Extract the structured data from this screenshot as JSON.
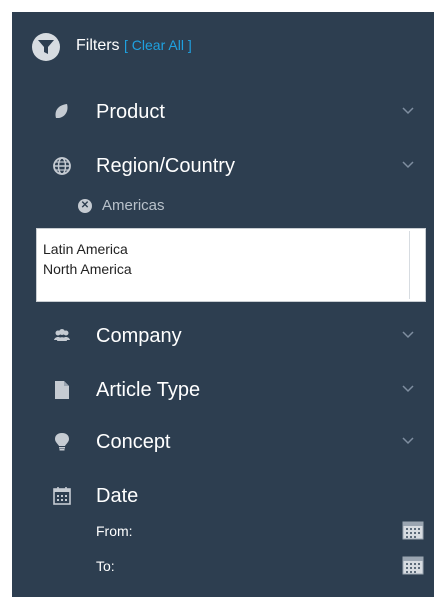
{
  "header": {
    "title": "Filters",
    "clear_all": "[ Clear All ]"
  },
  "filters": {
    "product": "Product",
    "region": "Region/Country",
    "company": "Company",
    "article_type": "Article Type",
    "concept": "Concept",
    "date": "Date"
  },
  "region_selected": {
    "chip": "Americas"
  },
  "region_options": [
    "Latin America",
    "North America"
  ],
  "date": {
    "from_label": "From:",
    "to_label": "To:"
  },
  "icons": {
    "header": "filter-icon",
    "product": "leaf-icon",
    "region": "globe-icon",
    "company": "users-icon",
    "article_type": "document-icon",
    "concept": "lightbulb-icon",
    "date": "calendar-icon",
    "expand": "chevron-down-icon",
    "remove": "close-circle-icon"
  },
  "colors": {
    "panel_bg": "#2d3e50",
    "accent": "#1fa1e0",
    "icon": "#c5cbd2"
  }
}
